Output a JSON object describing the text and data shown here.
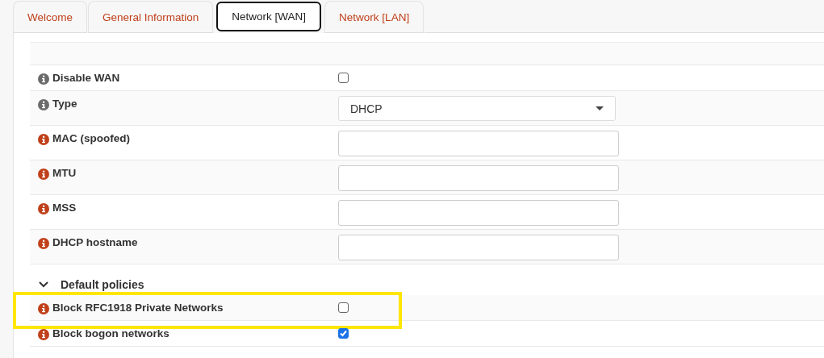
{
  "tabs": [
    {
      "label": "Welcome",
      "selected": false
    },
    {
      "label": "General Information",
      "selected": false
    },
    {
      "label": "Network [WAN]",
      "selected": true
    },
    {
      "label": "Network [LAN]",
      "selected": false
    }
  ],
  "rows": [
    {
      "kind": "checkbox",
      "label": "Disable WAN",
      "color": "#6b6b6b",
      "checked": false,
      "highlighted": false
    },
    {
      "kind": "select",
      "label": "Type",
      "color": "#6b6b6b",
      "value": "DHCP"
    },
    {
      "kind": "text",
      "label": "MAC (spoofed)",
      "color": "#c0401a"
    },
    {
      "kind": "text",
      "label": "MTU",
      "color": "#c0401a"
    },
    {
      "kind": "text",
      "label": "MSS",
      "color": "#c0401a"
    },
    {
      "kind": "text",
      "label": "DHCP hostname",
      "color": "#c0401a"
    },
    {
      "kind": "section",
      "label": "Default policies",
      "expanded": true
    },
    {
      "kind": "checkbox",
      "label": "Block RFC1918 Private Networks",
      "color": "#c0401a",
      "checked": false,
      "highlighted": true
    },
    {
      "kind": "checkbox",
      "label": "Block bogon networks",
      "color": "#c0401a",
      "checked": true,
      "highlighted": false
    }
  ]
}
